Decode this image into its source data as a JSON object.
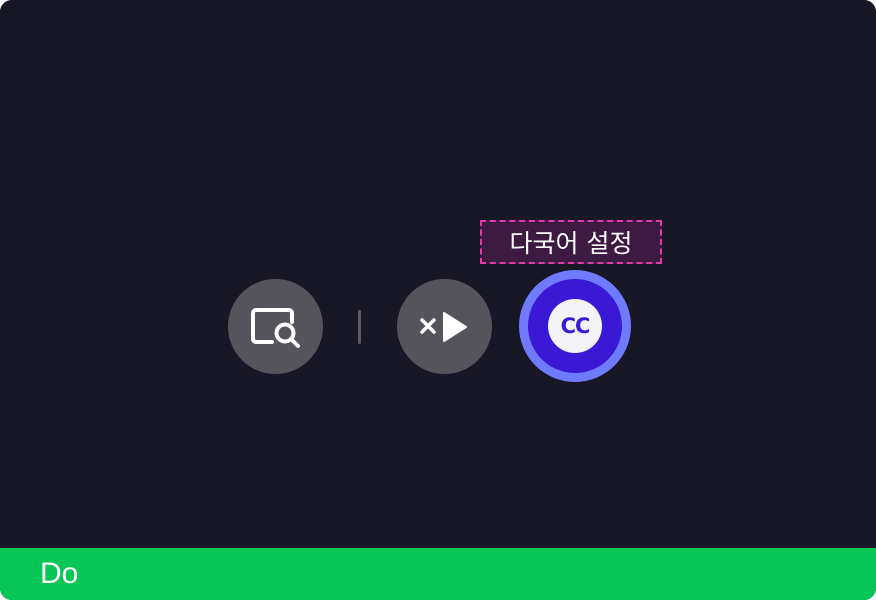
{
  "player": {
    "controls": {
      "search_icon": "search-screen-icon",
      "skip_icon": "close-play-icon",
      "subtitles_icon": "cc-icon",
      "subtitles_label": "CC"
    },
    "tooltip": {
      "text": "다국어 설정"
    }
  },
  "footer": {
    "label": "Do"
  },
  "colors": {
    "background": "#181725",
    "control_bg": "#55545d",
    "cc_ring": "#6f7bff",
    "cc_core": "#3a18d6",
    "tooltip_border": "#e23aa6",
    "footer_bg": "#06c755"
  }
}
